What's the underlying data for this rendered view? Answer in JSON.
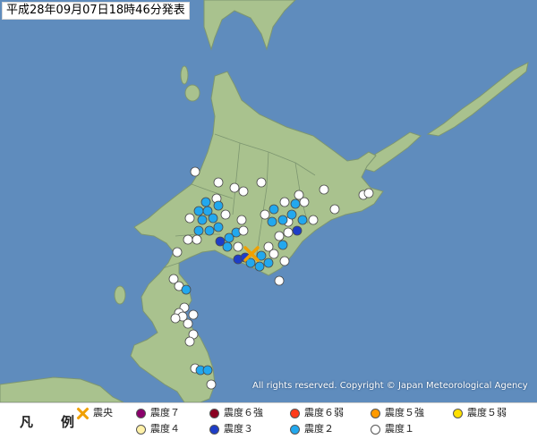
{
  "header": {
    "title": "平成28年09月07日18時46分発表"
  },
  "copyright": "All rights reserved. Copyright © Japan Meteorological Agency",
  "colors": {
    "sea": "#5f8cbd",
    "land": "#a9c28e",
    "border": "#7d9670",
    "epicenter": "#f0a000",
    "int7": "#8a006b",
    "int6_upper": "#8a0020",
    "int6_lower": "#ff3a1a",
    "int5_upper": "#ff9a00",
    "int5_lower": "#ffe000",
    "int4": "#fff1a8",
    "int3": "#1d3dc8",
    "int2": "#22a8ee",
    "int1": "#ffffff"
  },
  "legend": {
    "title": "凡　例",
    "epicenter": "震央",
    "int7": "震度７",
    "int6_upper": "震度６強",
    "int6_lower": "震度６弱",
    "int5_upper": "震度５強",
    "int5_lower": "震度５弱",
    "int4": "震度４",
    "int3": "震度３",
    "int2": "震度２",
    "int1": "震度１"
  }
}
